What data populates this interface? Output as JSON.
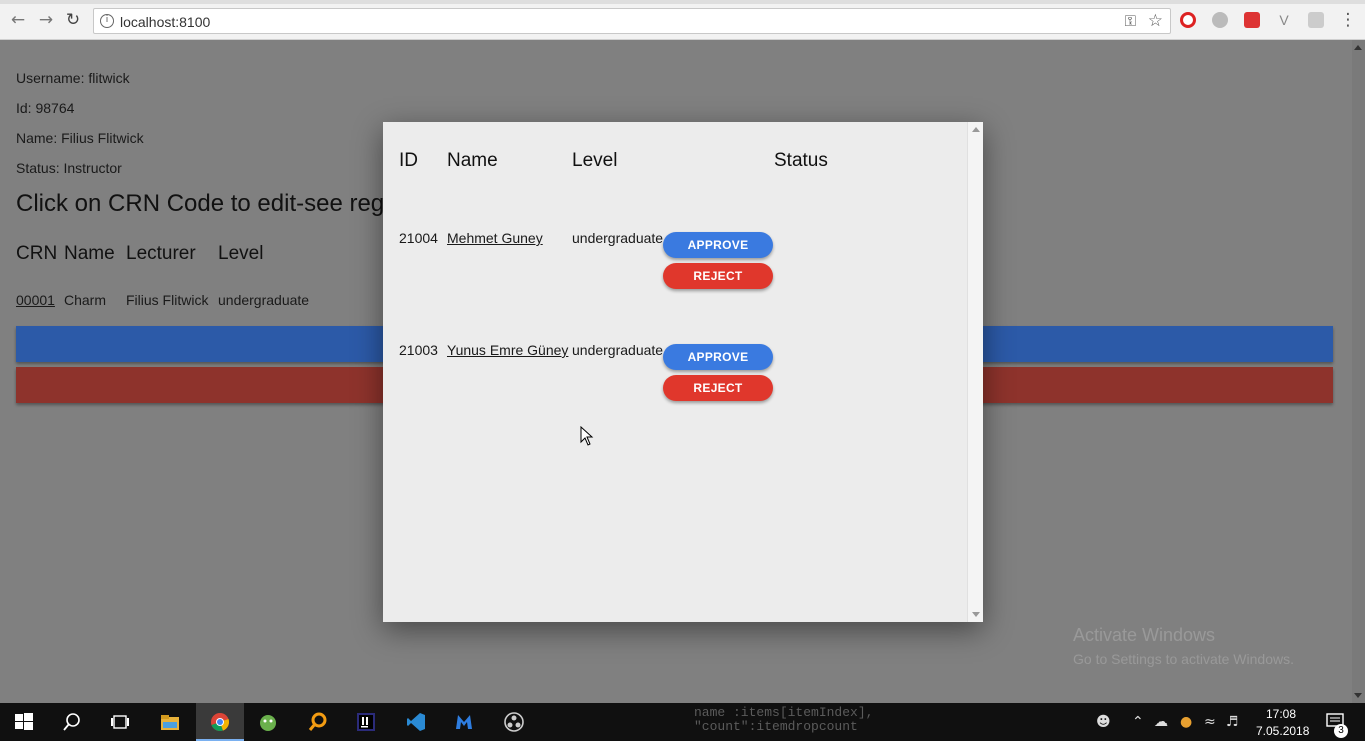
{
  "browser": {
    "url": "localhost:8100"
  },
  "user": {
    "username_line": "Username: flitwick",
    "id_line": "Id: 98764",
    "name_line": "Name: Filius Flitwick",
    "status_line": "Status: Instructor"
  },
  "page": {
    "heading": "Click on CRN Code to edit-see registrations",
    "course_headers": {
      "crn": "CRN",
      "name": "Name",
      "lecturer": "Lecturer",
      "level": "Level"
    },
    "course_rows": [
      {
        "crn": "00001",
        "name": "Charm",
        "lecturer": "Filius Flitwick",
        "level": "undergraduate"
      }
    ],
    "colors": {
      "primary_bar": "#2c5aa8",
      "danger_bar": "#8e332c"
    }
  },
  "modal": {
    "headers": {
      "id": "ID",
      "name": "Name",
      "level": "Level",
      "status": "Status"
    },
    "rows": [
      {
        "id": "21004",
        "name": "Mehmet Guney",
        "level": "undergraduate",
        "approve_label": "APPROVE",
        "reject_label": "REJECT"
      },
      {
        "id": "21003",
        "name": "Yunus Emre Güney",
        "level": "undergraduate",
        "approve_label": "APPROVE",
        "reject_label": "REJECT"
      }
    ],
    "colors": {
      "approve": "#3a7ae0",
      "reject": "#e0372c"
    }
  },
  "watermark": {
    "title": "Activate Windows",
    "subtitle": "Go to Settings to activate Windows."
  },
  "taskbar": {
    "time": "17:08",
    "date": "7.05.2018",
    "notification_count": "3",
    "code_line_1": "name :items[itemIndex],",
    "code_line_2": "\"count\":itemdropcount"
  }
}
